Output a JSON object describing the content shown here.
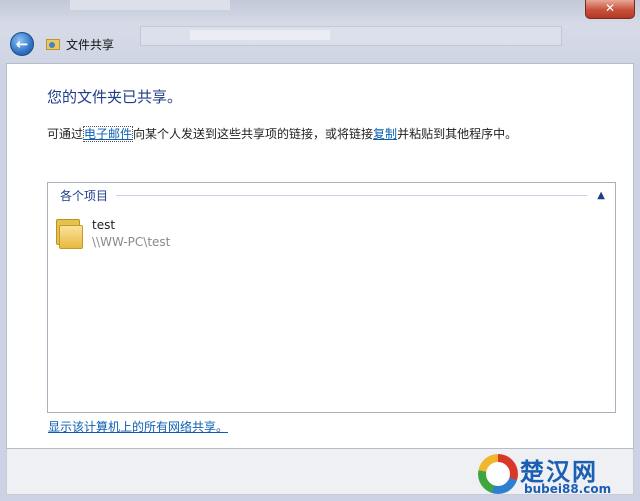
{
  "window": {
    "title": "文件共享",
    "close_glyph": "✕"
  },
  "dialog": {
    "heading": "您的文件夹已共享。",
    "desc_prefix": "可通过",
    "desc_email_link": "电子邮件",
    "desc_middle": "向某个人发送到这些共享项的链接，或将链接",
    "desc_copy_link": "复制",
    "desc_suffix": "并粘贴到其他程序中。"
  },
  "items_group": {
    "label": "各个项目",
    "items": [
      {
        "name": "test",
        "path": "\\\\WW-PC\\test",
        "icon": "folder-icon"
      }
    ]
  },
  "footer_link": "显示该计算机上的所有网络共享。",
  "watermark": {
    "title": "楚汉网",
    "subtitle": "bubei88.com"
  },
  "colors": {
    "heading": "#1f3d8a",
    "link": "#0b5fb3",
    "close": "#c9503b"
  }
}
